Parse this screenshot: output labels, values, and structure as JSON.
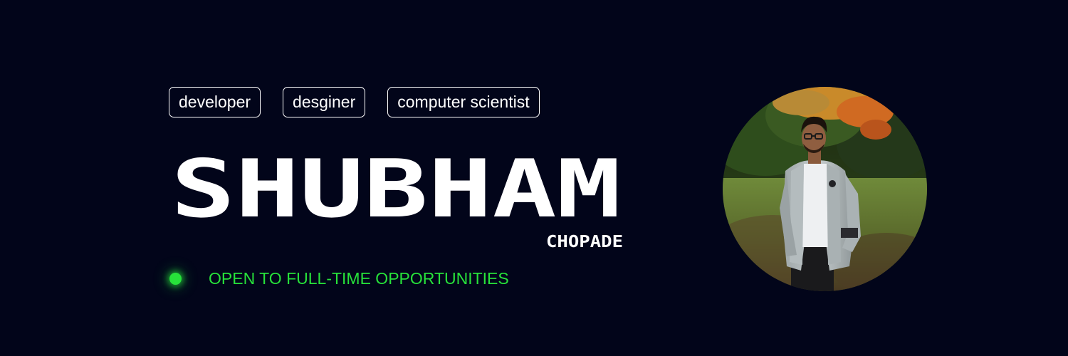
{
  "tags": [
    "developer",
    "desginer",
    "computer scientist"
  ],
  "name": {
    "first": "SHUBHAM",
    "last": "CHOPADE"
  },
  "status": {
    "text": "OPEN TO FULL-TIME OPPORTUNITIES",
    "color": "#27e23a"
  },
  "colors": {
    "background": "#02051a",
    "text": "#ffffff",
    "accent": "#27e23a"
  },
  "photo": {
    "alt": "profile-photo"
  }
}
